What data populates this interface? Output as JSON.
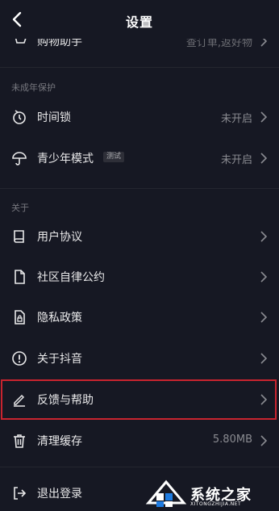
{
  "header": {
    "title": "设置"
  },
  "top_partial": {
    "label": "购物助手",
    "value": "查订单,返好物"
  },
  "sections": {
    "minor": {
      "title": "未成年保护",
      "items": [
        {
          "label": "时间锁",
          "value": "未开启",
          "icon": "timer-lock-icon"
        },
        {
          "label": "青少年模式",
          "badge": "测试",
          "value": "未开启",
          "icon": "umbrella-icon"
        }
      ]
    },
    "about": {
      "title": "关于",
      "items": [
        {
          "label": "用户协议",
          "icon": "book-icon"
        },
        {
          "label": "社区自律公约",
          "icon": "document-icon"
        },
        {
          "label": "隐私政策",
          "icon": "privacy-lock-document-icon"
        },
        {
          "label": "关于抖音",
          "icon": "info-icon"
        },
        {
          "label": "反馈与帮助",
          "icon": "edit-pen-icon",
          "highlighted": true
        },
        {
          "label": "清理缓存",
          "value": "5.80MB",
          "icon": "trash-icon"
        },
        {
          "label": "退出登录",
          "icon": "logout-icon"
        }
      ]
    }
  },
  "watermark": {
    "text": "系统之家",
    "url": "XITONGZHIJIA.NET"
  },
  "colors": {
    "background": "#161823",
    "text": "#e9e9ea",
    "muted": "#8a8b91",
    "highlight_border": "#c8242f"
  }
}
